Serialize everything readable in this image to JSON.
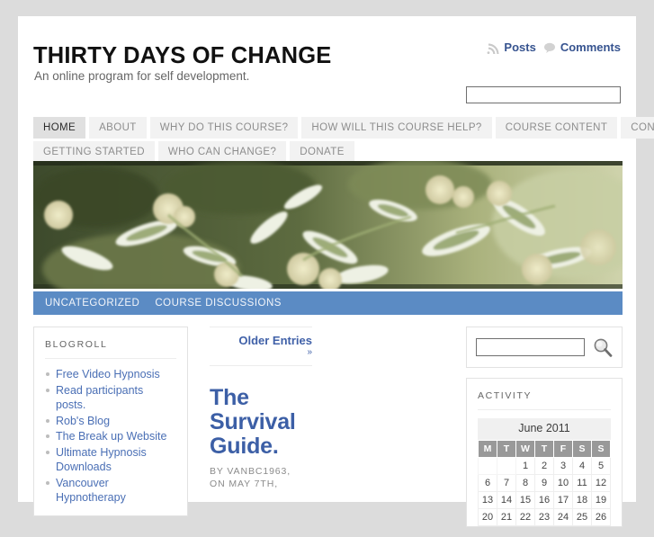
{
  "site": {
    "title": "THIRTY DAYS OF CHANGE",
    "tagline": "An online program for self development."
  },
  "header": {
    "feed_posts_label": "Posts",
    "feed_comments_label": "Comments",
    "posts_icon": "rss-icon",
    "comments_icon": "comment-bubble-icon",
    "search_value": "",
    "search_placeholder": ""
  },
  "nav": {
    "rows": [
      [
        {
          "label": "HOME",
          "active": true
        },
        {
          "label": "ABOUT",
          "active": false
        },
        {
          "label": "WHY DO THIS COURSE?",
          "active": false
        },
        {
          "label": "HOW WILL THIS COURSE HELP?",
          "active": false
        },
        {
          "label": "COURSE CONTENT",
          "active": false
        },
        {
          "label": "CONTACT",
          "active": false
        }
      ],
      [
        {
          "label": "GETTING STARTED",
          "active": false
        },
        {
          "label": "WHO CAN CHANGE?",
          "active": false
        },
        {
          "label": "DONATE",
          "active": false
        }
      ]
    ]
  },
  "banner": {
    "alt": "Variegated foliage with cream flower clusters",
    "colors": {
      "dark_green": "#2f3a24",
      "mid_green": "#6a7a४2",
      "cream": "#e8e6cf",
      "white_leaf": "#f2f4ea"
    }
  },
  "category_bar": {
    "background": "#5b8bc4",
    "links": [
      "UNCATEGORIZED",
      "COURSE DISCUSSIONS"
    ]
  },
  "sidebar_left": {
    "blogroll": {
      "title": "BLOGROLL",
      "links": [
        "Free Video Hypnosis",
        "Read participants posts.",
        "Rob's Blog",
        "The Break up Website",
        "Ultimate Hypnosis Downloads",
        "Vancouver Hypnotherapy"
      ]
    }
  },
  "main": {
    "pagination": {
      "older_entries_label": "Older Entries",
      "chevron": "»"
    },
    "post": {
      "title": "The Survival Guide.",
      "meta_author": "BY VANBC1963,",
      "meta_date": "ON MAY 7TH,"
    }
  },
  "sidebar_right": {
    "search": {
      "value": "",
      "placeholder": "",
      "icon": "magnifier-icon"
    },
    "activity": {
      "title": "ACTIVITY",
      "calendar": {
        "caption": "June 2011",
        "day_headers": [
          "M",
          "T",
          "W",
          "T",
          "F",
          "S",
          "S"
        ],
        "weeks": [
          [
            "",
            "",
            "1",
            "2",
            "3",
            "4",
            "5"
          ],
          [
            "6",
            "7",
            "8",
            "9",
            "10",
            "11",
            "12"
          ],
          [
            "13",
            "14",
            "15",
            "16",
            "17",
            "18",
            "19"
          ],
          [
            "20",
            "21",
            "22",
            "23",
            "24",
            "25",
            "26"
          ]
        ]
      }
    }
  },
  "theme": {
    "page_background": "#dcdcdc",
    "content_background": "#ffffff",
    "link_blue": "#4a6fb5",
    "heading_blue": "#3c5fa6",
    "accent_blue": "#5b8bc4"
  }
}
